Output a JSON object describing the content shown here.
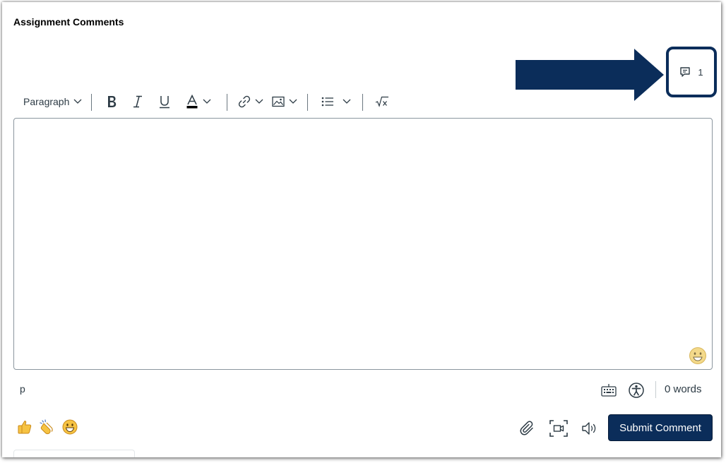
{
  "header": {
    "title": "Assignment Comments"
  },
  "comments": {
    "count": "1",
    "icon": "comment-icon"
  },
  "toolbar": {
    "block_format": "Paragraph",
    "buttons": [
      "bold",
      "italic",
      "underline",
      "text-color",
      "link",
      "image",
      "list",
      "equation"
    ]
  },
  "editor": {
    "content": "",
    "emoji_icon": "emoji-picker-icon"
  },
  "statusbar": {
    "path": "p",
    "word_count": "0 words"
  },
  "reactions": [
    "thumbs-up",
    "clapping-hands",
    "grinning-face"
  ],
  "actions": {
    "submit_label": "Submit Comment"
  },
  "colors": {
    "brand": "#0b2d5a",
    "text": "#2d3b45",
    "border": "#8b969e"
  }
}
